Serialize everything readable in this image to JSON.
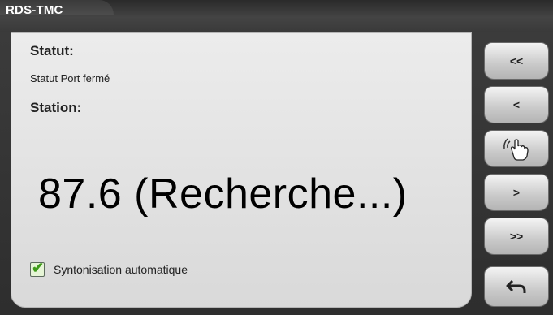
{
  "window": {
    "title": "RDS-TMC"
  },
  "status": {
    "label": "Statut:",
    "value": "Statut Port fermé"
  },
  "station": {
    "label": "Station:",
    "frequency_text": "87.6 (Recherche...)"
  },
  "auto_tune": {
    "label": "Syntonisation automatique",
    "checked": true
  },
  "buttons": {
    "rewind_fast": "<<",
    "rewind": "<",
    "touch_icon": "hand-touch-icon",
    "forward": ">",
    "forward_fast": ">>",
    "back_icon": "undo-arrow-icon"
  },
  "colors": {
    "check_green": "#3f9c1a",
    "frame_dark": "#333333",
    "panel_gray": "#e3e3e3"
  }
}
